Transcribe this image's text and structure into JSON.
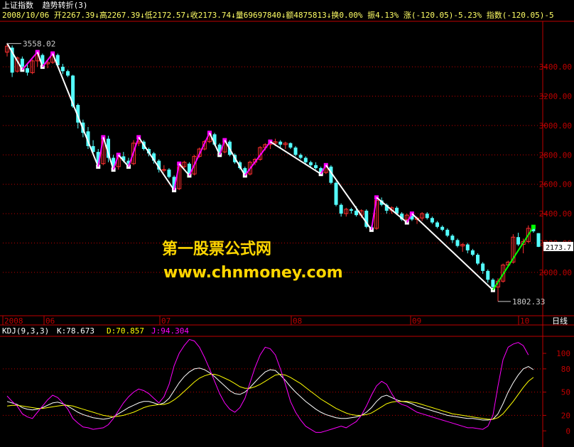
{
  "header": {
    "title": "上证指数",
    "indicator": "趋势转折(3)",
    "quote_line": "2008/10/06 开2267.39↓高2267.39↓低2172.57↓收2173.74↓量69697840↓额4875813↓换0.00% 振4.13% 涨(-120.05)-5.23% 指数(-120.05)-5"
  },
  "watermark": {
    "line1": "第一股票公式网",
    "line2": "www.chnmoney.com"
  },
  "colors": {
    "up": "#ff3030",
    "down": "#54ffff",
    "trend_up": "#ff00ff",
    "trend_down": "#ffffff",
    "trend_last": "#00ff00",
    "axis": "#c00000",
    "k_line": "#ffffff",
    "d_line": "#ffff00",
    "j_line": "#ff00ff"
  },
  "chart_data": [
    {
      "type": "candlestick",
      "title": "上证指数",
      "ylim": [
        1700,
        3700
      ],
      "yticks": [
        2000,
        2200,
        2400,
        2600,
        2800,
        3000,
        3200,
        3400
      ],
      "x_labels": [
        "2008",
        "06",
        "07",
        "08",
        "09",
        "10",
        "日线"
      ],
      "annotations": {
        "high": "3558.02",
        "low": "1802.33",
        "last": "2173.7"
      },
      "candles": [
        {
          "o": 3500,
          "h": 3560,
          "l": 3470,
          "c": 3540
        },
        {
          "o": 3530,
          "h": 3545,
          "l": 3330,
          "c": 3360
        },
        {
          "o": 3370,
          "h": 3470,
          "l": 3360,
          "c": 3460
        },
        {
          "o": 3455,
          "h": 3470,
          "l": 3380,
          "c": 3400
        },
        {
          "o": 3390,
          "h": 3420,
          "l": 3340,
          "c": 3360
        },
        {
          "o": 3360,
          "h": 3450,
          "l": 3350,
          "c": 3440
        },
        {
          "o": 3440,
          "h": 3500,
          "l": 3400,
          "c": 3490
        },
        {
          "o": 3480,
          "h": 3490,
          "l": 3400,
          "c": 3420
        },
        {
          "o": 3420,
          "h": 3450,
          "l": 3390,
          "c": 3430
        },
        {
          "o": 3430,
          "h": 3490,
          "l": 3420,
          "c": 3480
        },
        {
          "o": 3480,
          "h": 3490,
          "l": 3400,
          "c": 3410
        },
        {
          "o": 3400,
          "h": 3420,
          "l": 3350,
          "c": 3370
        },
        {
          "o": 3370,
          "h": 3380,
          "l": 3330,
          "c": 3340
        },
        {
          "o": 3340,
          "h": 3345,
          "l": 3120,
          "c": 3130
        },
        {
          "o": 3140,
          "h": 3150,
          "l": 2980,
          "c": 3020
        },
        {
          "o": 3020,
          "h": 3040,
          "l": 2920,
          "c": 2950
        },
        {
          "o": 2960,
          "h": 2990,
          "l": 2840,
          "c": 2860
        },
        {
          "o": 2860,
          "h": 2900,
          "l": 2800,
          "c": 2820
        },
        {
          "o": 2820,
          "h": 2840,
          "l": 2720,
          "c": 2740
        },
        {
          "o": 2740,
          "h": 2920,
          "l": 2730,
          "c": 2910
        },
        {
          "o": 2910,
          "h": 2930,
          "l": 2750,
          "c": 2780
        },
        {
          "o": 2780,
          "h": 2800,
          "l": 2700,
          "c": 2720
        },
        {
          "o": 2720,
          "h": 2800,
          "l": 2700,
          "c": 2790
        },
        {
          "o": 2790,
          "h": 2820,
          "l": 2750,
          "c": 2760
        },
        {
          "o": 2760,
          "h": 2780,
          "l": 2720,
          "c": 2740
        },
        {
          "o": 2740,
          "h": 2900,
          "l": 2730,
          "c": 2880
        },
        {
          "o": 2880,
          "h": 2920,
          "l": 2860,
          "c": 2890
        },
        {
          "o": 2890,
          "h": 2900,
          "l": 2830,
          "c": 2840
        },
        {
          "o": 2840,
          "h": 2850,
          "l": 2790,
          "c": 2810
        },
        {
          "o": 2810,
          "h": 2820,
          "l": 2740,
          "c": 2760
        },
        {
          "o": 2760,
          "h": 2770,
          "l": 2680,
          "c": 2700
        },
        {
          "o": 2700,
          "h": 2730,
          "l": 2680,
          "c": 2700
        },
        {
          "o": 2700,
          "h": 2710,
          "l": 2640,
          "c": 2650
        },
        {
          "o": 2650,
          "h": 2660,
          "l": 2560,
          "c": 2570
        },
        {
          "o": 2570,
          "h": 2740,
          "l": 2560,
          "c": 2720
        },
        {
          "o": 2720,
          "h": 2760,
          "l": 2710,
          "c": 2750
        },
        {
          "o": 2740,
          "h": 2750,
          "l": 2660,
          "c": 2670
        },
        {
          "o": 2670,
          "h": 2800,
          "l": 2660,
          "c": 2790
        },
        {
          "o": 2790,
          "h": 2850,
          "l": 2780,
          "c": 2840
        },
        {
          "o": 2840,
          "h": 2900,
          "l": 2830,
          "c": 2890
        },
        {
          "o": 2890,
          "h": 2950,
          "l": 2880,
          "c": 2940
        },
        {
          "o": 2940,
          "h": 2950,
          "l": 2860,
          "c": 2870
        },
        {
          "o": 2870,
          "h": 2880,
          "l": 2800,
          "c": 2820
        },
        {
          "o": 2820,
          "h": 2900,
          "l": 2810,
          "c": 2890
        },
        {
          "o": 2890,
          "h": 2900,
          "l": 2790,
          "c": 2800
        },
        {
          "o": 2800,
          "h": 2810,
          "l": 2740,
          "c": 2750
        },
        {
          "o": 2750,
          "h": 2760,
          "l": 2700,
          "c": 2710
        },
        {
          "o": 2710,
          "h": 2720,
          "l": 2660,
          "c": 2670
        },
        {
          "o": 2670,
          "h": 2760,
          "l": 2660,
          "c": 2750
        },
        {
          "o": 2750,
          "h": 2780,
          "l": 2730,
          "c": 2770
        },
        {
          "o": 2770,
          "h": 2860,
          "l": 2760,
          "c": 2850
        },
        {
          "o": 2850,
          "h": 2880,
          "l": 2830,
          "c": 2870
        },
        {
          "o": 2870,
          "h": 2890,
          "l": 2840,
          "c": 2880
        },
        {
          "o": 2880,
          "h": 2910,
          "l": 2860,
          "c": 2890
        },
        {
          "o": 2890,
          "h": 2900,
          "l": 2850,
          "c": 2870
        },
        {
          "o": 2870,
          "h": 2890,
          "l": 2840,
          "c": 2880
        },
        {
          "o": 2880,
          "h": 2885,
          "l": 2840,
          "c": 2850
        },
        {
          "o": 2850,
          "h": 2860,
          "l": 2790,
          "c": 2800
        },
        {
          "o": 2800,
          "h": 2810,
          "l": 2770,
          "c": 2780
        },
        {
          "o": 2780,
          "h": 2790,
          "l": 2740,
          "c": 2750
        },
        {
          "o": 2750,
          "h": 2760,
          "l": 2720,
          "c": 2730
        },
        {
          "o": 2730,
          "h": 2750,
          "l": 2700,
          "c": 2710
        },
        {
          "o": 2710,
          "h": 2720,
          "l": 2670,
          "c": 2680
        },
        {
          "o": 2680,
          "h": 2730,
          "l": 2670,
          "c": 2720
        },
        {
          "o": 2720,
          "h": 2730,
          "l": 2600,
          "c": 2610
        },
        {
          "o": 2610,
          "h": 2620,
          "l": 2450,
          "c": 2460
        },
        {
          "o": 2460,
          "h": 2470,
          "l": 2380,
          "c": 2400
        },
        {
          "o": 2400,
          "h": 2440,
          "l": 2380,
          "c": 2430
        },
        {
          "o": 2430,
          "h": 2440,
          "l": 2400,
          "c": 2420
        },
        {
          "o": 2420,
          "h": 2450,
          "l": 2380,
          "c": 2390
        },
        {
          "o": 2390,
          "h": 2430,
          "l": 2370,
          "c": 2420
        },
        {
          "o": 2420,
          "h": 2430,
          "l": 2300,
          "c": 2310
        },
        {
          "o": 2310,
          "h": 2320,
          "l": 2290,
          "c": 2300
        },
        {
          "o": 2300,
          "h": 2510,
          "l": 2290,
          "c": 2490
        },
        {
          "o": 2490,
          "h": 2510,
          "l": 2450,
          "c": 2460
        },
        {
          "o": 2460,
          "h": 2470,
          "l": 2400,
          "c": 2420
        },
        {
          "o": 2420,
          "h": 2450,
          "l": 2400,
          "c": 2440
        },
        {
          "o": 2440,
          "h": 2450,
          "l": 2390,
          "c": 2400
        },
        {
          "o": 2400,
          "h": 2410,
          "l": 2350,
          "c": 2360
        },
        {
          "o": 2360,
          "h": 2400,
          "l": 2340,
          "c": 2390
        },
        {
          "o": 2390,
          "h": 2400,
          "l": 2350,
          "c": 2360
        },
        {
          "o": 2360,
          "h": 2380,
          "l": 2330,
          "c": 2370
        },
        {
          "o": 2370,
          "h": 2410,
          "l": 2350,
          "c": 2400
        },
        {
          "o": 2400,
          "h": 2410,
          "l": 2360,
          "c": 2370
        },
        {
          "o": 2370,
          "h": 2380,
          "l": 2330,
          "c": 2340
        },
        {
          "o": 2340,
          "h": 2350,
          "l": 2300,
          "c": 2310
        },
        {
          "o": 2310,
          "h": 2320,
          "l": 2280,
          "c": 2290
        },
        {
          "o": 2290,
          "h": 2300,
          "l": 2240,
          "c": 2250
        },
        {
          "o": 2250,
          "h": 2260,
          "l": 2200,
          "c": 2220
        },
        {
          "o": 2220,
          "h": 2230,
          "l": 2170,
          "c": 2180
        },
        {
          "o": 2180,
          "h": 2200,
          "l": 2140,
          "c": 2190
        },
        {
          "o": 2190,
          "h": 2200,
          "l": 2130,
          "c": 2150
        },
        {
          "o": 2150,
          "h": 2160,
          "l": 2110,
          "c": 2120
        },
        {
          "o": 2120,
          "h": 2130,
          "l": 2050,
          "c": 2060
        },
        {
          "o": 2060,
          "h": 2070,
          "l": 1990,
          "c": 2010
        },
        {
          "o": 2010,
          "h": 2020,
          "l": 1930,
          "c": 1950
        },
        {
          "o": 1950,
          "h": 1960,
          "l": 1880,
          "c": 1900
        },
        {
          "o": 1900,
          "h": 1960,
          "l": 1802,
          "c": 1940
        },
        {
          "o": 1940,
          "h": 2060,
          "l": 1930,
          "c": 2050
        },
        {
          "o": 2050,
          "h": 2080,
          "l": 2040,
          "c": 2070
        },
        {
          "o": 2070,
          "h": 2260,
          "l": 2060,
          "c": 2240
        },
        {
          "o": 2240,
          "h": 2270,
          "l": 2180,
          "c": 2190
        },
        {
          "o": 2190,
          "h": 2230,
          "l": 2130,
          "c": 2210
        },
        {
          "o": 2210,
          "h": 2320,
          "l": 2200,
          "c": 2300
        },
        {
          "o": 2300,
          "h": 2310,
          "l": 2270,
          "c": 2280
        },
        {
          "o": 2267,
          "h": 2267,
          "l": 2172,
          "c": 2174
        }
      ],
      "trend_segments": [
        {
          "from": 0,
          "to": 3,
          "dir": "down"
        },
        {
          "from": 3,
          "to": 6,
          "dir": "up"
        },
        {
          "from": 6,
          "to": 7,
          "dir": "down"
        },
        {
          "from": 7,
          "to": 9,
          "dir": "up"
        },
        {
          "from": 9,
          "to": 18,
          "dir": "down"
        },
        {
          "from": 18,
          "to": 19,
          "dir": "up"
        },
        {
          "from": 19,
          "to": 21,
          "dir": "down"
        },
        {
          "from": 21,
          "to": 22,
          "dir": "up"
        },
        {
          "from": 22,
          "to": 24,
          "dir": "down"
        },
        {
          "from": 24,
          "to": 26,
          "dir": "up"
        },
        {
          "from": 26,
          "to": 33,
          "dir": "down"
        },
        {
          "from": 33,
          "to": 34,
          "dir": "up"
        },
        {
          "from": 34,
          "to": 36,
          "dir": "down"
        },
        {
          "from": 36,
          "to": 40,
          "dir": "up"
        },
        {
          "from": 40,
          "to": 42,
          "dir": "down"
        },
        {
          "from": 42,
          "to": 43,
          "dir": "up"
        },
        {
          "from": 43,
          "to": 47,
          "dir": "down"
        },
        {
          "from": 47,
          "to": 52,
          "dir": "up"
        },
        {
          "from": 52,
          "to": 62,
          "dir": "down"
        },
        {
          "from": 62,
          "to": 63,
          "dir": "up"
        },
        {
          "from": 63,
          "to": 72,
          "dir": "down"
        },
        {
          "from": 72,
          "to": 73,
          "dir": "up"
        },
        {
          "from": 73,
          "to": 79,
          "dir": "down"
        },
        {
          "from": 79,
          "to": 80,
          "dir": "up"
        },
        {
          "from": 80,
          "to": 96,
          "dir": "down"
        },
        {
          "from": 96,
          "to": 104,
          "dir": "last"
        }
      ]
    },
    {
      "type": "line",
      "title": "KDJ(9,3,3)",
      "ylim": [
        -8,
        122
      ],
      "yticks": [
        0,
        20,
        50,
        80,
        100
      ],
      "legend": {
        "K": "78.673",
        "D": "70.857",
        "J": "94.304"
      },
      "series": [
        {
          "name": "K",
          "values": [
            38,
            36,
            34,
            30,
            28,
            27,
            28,
            30,
            33,
            36,
            37,
            35,
            32,
            28,
            24,
            21,
            19,
            17,
            16,
            15,
            16,
            18,
            22,
            26,
            30,
            33,
            36,
            38,
            38,
            36,
            34,
            36,
            42,
            52,
            62,
            70,
            76,
            80,
            81,
            79,
            75,
            70,
            64,
            58,
            52,
            48,
            47,
            50,
            56,
            63,
            70,
            76,
            79,
            78,
            72,
            65,
            57,
            50,
            44,
            38,
            33,
            28,
            24,
            21,
            19,
            17,
            16,
            16,
            17,
            18,
            20,
            24,
            30,
            38,
            44,
            46,
            43,
            40,
            38,
            37,
            35,
            32,
            30,
            28,
            26,
            24,
            22,
            20,
            19,
            18,
            17,
            16,
            16,
            15,
            14,
            14,
            15,
            22,
            35,
            50,
            62,
            72,
            80,
            83,
            79
          ]
        },
        {
          "name": "D",
          "values": [
            32,
            33,
            33,
            32,
            31,
            30,
            29,
            29,
            30,
            31,
            32,
            33,
            33,
            32,
            30,
            28,
            26,
            24,
            22,
            20,
            19,
            18,
            19,
            20,
            22,
            24,
            27,
            30,
            32,
            33,
            34,
            34,
            36,
            40,
            45,
            51,
            57,
            63,
            68,
            71,
            73,
            73,
            71,
            68,
            65,
            61,
            57,
            55,
            55,
            57,
            60,
            64,
            68,
            72,
            73,
            72,
            69,
            65,
            61,
            56,
            51,
            46,
            41,
            37,
            33,
            29,
            26,
            23,
            21,
            20,
            20,
            21,
            23,
            27,
            31,
            35,
            37,
            38,
            38,
            38,
            37,
            36,
            34,
            32,
            30,
            28,
            26,
            24,
            22,
            21,
            20,
            19,
            18,
            17,
            16,
            15,
            15,
            17,
            22,
            30,
            38,
            47,
            56,
            64,
            69
          ]
        },
        {
          "name": "J",
          "values": [
            45,
            38,
            32,
            22,
            18,
            16,
            24,
            32,
            40,
            46,
            43,
            36,
            28,
            16,
            10,
            5,
            4,
            2,
            3,
            4,
            8,
            16,
            26,
            36,
            44,
            50,
            54,
            52,
            48,
            42,
            36,
            44,
            60,
            84,
            100,
            110,
            118,
            116,
            108,
            95,
            80,
            64,
            48,
            36,
            28,
            24,
            30,
            42,
            62,
            82,
            98,
            108,
            106,
            98,
            80,
            60,
            38,
            24,
            14,
            6,
            2,
            -2,
            -2,
            0,
            2,
            4,
            6,
            4,
            8,
            12,
            20,
            32,
            46,
            58,
            64,
            60,
            48,
            38,
            34,
            32,
            28,
            24,
            22,
            20,
            18,
            16,
            14,
            12,
            10,
            8,
            6,
            4,
            4,
            3,
            2,
            6,
            20,
            58,
            92,
            108,
            112,
            114,
            110,
            98
          ]
        }
      ]
    }
  ]
}
